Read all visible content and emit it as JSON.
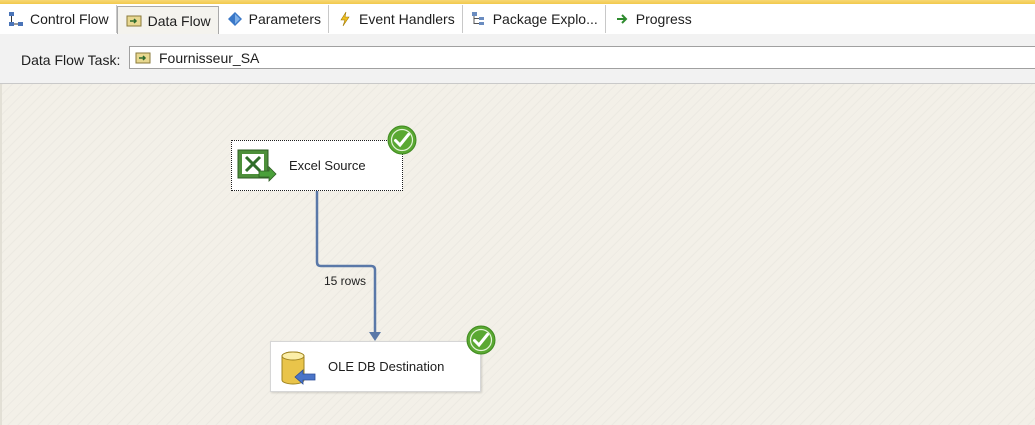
{
  "tabs": [
    {
      "label": "Control Flow",
      "icon": "control-flow-icon",
      "active": false
    },
    {
      "label": "Data Flow",
      "icon": "data-flow-icon",
      "active": true
    },
    {
      "label": "Parameters",
      "icon": "parameters-icon",
      "active": false
    },
    {
      "label": "Event Handlers",
      "icon": "event-handlers-icon",
      "active": false
    },
    {
      "label": "Package Explo...",
      "icon": "package-explorer-icon",
      "active": false
    },
    {
      "label": "Progress",
      "icon": "progress-icon",
      "active": false
    }
  ],
  "task_bar": {
    "label": "Data Flow Task:",
    "selected_task": "Fournisseur_SA",
    "selected_icon": "data-flow-task-icon"
  },
  "components": {
    "source": {
      "label": "Excel Source",
      "icon": "excel-source-icon",
      "status": "success"
    },
    "destination": {
      "label": "OLE DB Destination",
      "icon": "ole-db-destination-icon",
      "status": "success"
    }
  },
  "data_path": {
    "label": "15 rows"
  },
  "colors": {
    "accent": "#f2c94c",
    "path": "#5a78a8",
    "success": "#5aa832",
    "canvas": "#f3f0e8"
  }
}
